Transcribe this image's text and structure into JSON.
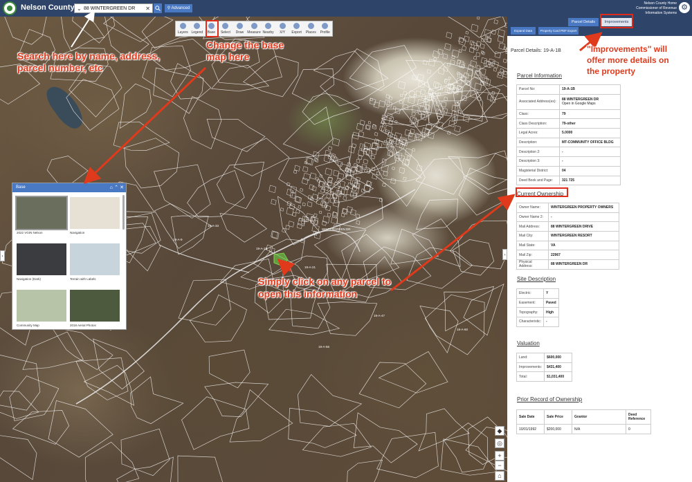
{
  "header": {
    "title": "Nelson County, VA",
    "search_value": "88 WINTERGREEN DR",
    "advanced_label": "Advanced",
    "right_lines": [
      "Nelson County Home",
      "Commissioner of Revenue",
      "Information Systems"
    ]
  },
  "toolbar": {
    "tools": [
      {
        "name": "tool-layers",
        "label": "Layers"
      },
      {
        "name": "tool-legend",
        "label": "Legend"
      },
      {
        "name": "tool-base",
        "label": "Base"
      },
      {
        "name": "tool-select",
        "label": "Select"
      },
      {
        "name": "tool-draw",
        "label": "Draw"
      },
      {
        "name": "tool-measure",
        "label": "Measure"
      },
      {
        "name": "tool-nearby",
        "label": "Nearby"
      },
      {
        "name": "tool-xy",
        "label": "X/Y"
      },
      {
        "name": "tool-export",
        "label": "Export"
      },
      {
        "name": "tool-places",
        "label": "Places"
      },
      {
        "name": "tool-profile",
        "label": "Profile"
      }
    ]
  },
  "base_panel": {
    "title": "Base",
    "maps": [
      {
        "label": "2022 VGIN Nelson",
        "color": "#6a6e5c"
      },
      {
        "label": "Navigation",
        "color": "#e6e1d4"
      },
      {
        "label": "Navigation (Dark)",
        "color": "#3a3c40"
      },
      {
        "label": "Terrain with Labels",
        "color": "#c8d4dc"
      },
      {
        "label": "Community Map",
        "color": "#b8c4a8"
      },
      {
        "label": "2018 Aerial Photos",
        "color": "#4d5a3e"
      }
    ]
  },
  "right_panel": {
    "tab_parcel": "Parcel Details",
    "tab_improvements": "Improvements",
    "btn_expand": "Expand Data",
    "btn_pdf": "Property Card PDF Export",
    "parcel_details_title": "Parcel Details: 19-A-1B",
    "parcel_info": {
      "heading": "Parcel Information",
      "rows": [
        {
          "k": "Parcel No:",
          "v": "19-A-1B"
        },
        {
          "k": "Associated Address(es):",
          "v": "88 WINTERGREEN DR",
          "v2": "Open in Google Maps"
        },
        {
          "k": "Class:",
          "v": "79"
        },
        {
          "k": "Class Description:",
          "v": "79-other"
        },
        {
          "k": "Legal Acres:",
          "v": "5.0000"
        },
        {
          "k": "Description:",
          "v": "MT-COMMUNITY OFFICE BLDG"
        },
        {
          "k": "Description 2:",
          "v": "-"
        },
        {
          "k": "Description 3:",
          "v": "-"
        },
        {
          "k": "Magisterial District:",
          "v": "04"
        },
        {
          "k": "Deed Book and Page:",
          "v": "321 725"
        }
      ]
    },
    "ownership": {
      "heading": "Current Ownership",
      "rows": [
        {
          "k": "Owner Name:",
          "v": "WINTERGREEN PROPERTY OWNERS"
        },
        {
          "k": "Owner Name 2:",
          "v": "-"
        },
        {
          "k": "Mail Address:",
          "v": "88 WINTERGREEN DRIVE"
        },
        {
          "k": "Mail City:",
          "v": "WINTERGREEN RESORT"
        },
        {
          "k": "Mail State:",
          "v": "VA"
        },
        {
          "k": "Mail Zip:",
          "v": "22967"
        },
        {
          "k": "Physical Address:",
          "v": "88 WINTERGREEN DR"
        }
      ]
    },
    "site": {
      "heading": "Site Description",
      "rows": [
        {
          "k": "Electric:",
          "v": "Y"
        },
        {
          "k": "Easement:",
          "v": "Paved"
        },
        {
          "k": "Topography:",
          "v": "High"
        },
        {
          "k": "Characteristic:",
          "v": "-"
        }
      ]
    },
    "valuation": {
      "heading": "Valuation",
      "rows": [
        {
          "k": "Land:",
          "v": "$600,000"
        },
        {
          "k": "Improvements:",
          "v": "$431,400"
        },
        {
          "k": "Total:",
          "v": "$1,031,400"
        }
      ]
    },
    "prior": {
      "heading": "Prior Record of Ownership",
      "cols": [
        "Sale Date",
        "Sale Price",
        "Grantor",
        "Deed Reference"
      ],
      "rows": [
        [
          "10/01/1992",
          "$200,000",
          "N/A",
          "0"
        ]
      ]
    }
  },
  "annotations": {
    "search": "Search here by name, address, parcel  number, etc",
    "base": "Change the base map here",
    "click": "Simply click on any parcel to open this information",
    "improvements": "\"Improvements\" will offer more details on the property"
  },
  "map_labels": [
    "19-A-1B",
    "19-A-21",
    "19-A-33",
    "19-A-9",
    "19-A-47",
    "19-A-56",
    "19-A-12",
    "19-A-60",
    "WINTERGREEN DR"
  ],
  "colors": {
    "header": "#2e4468",
    "accent": "#4a79c4",
    "annotation": "#e03a1c"
  }
}
